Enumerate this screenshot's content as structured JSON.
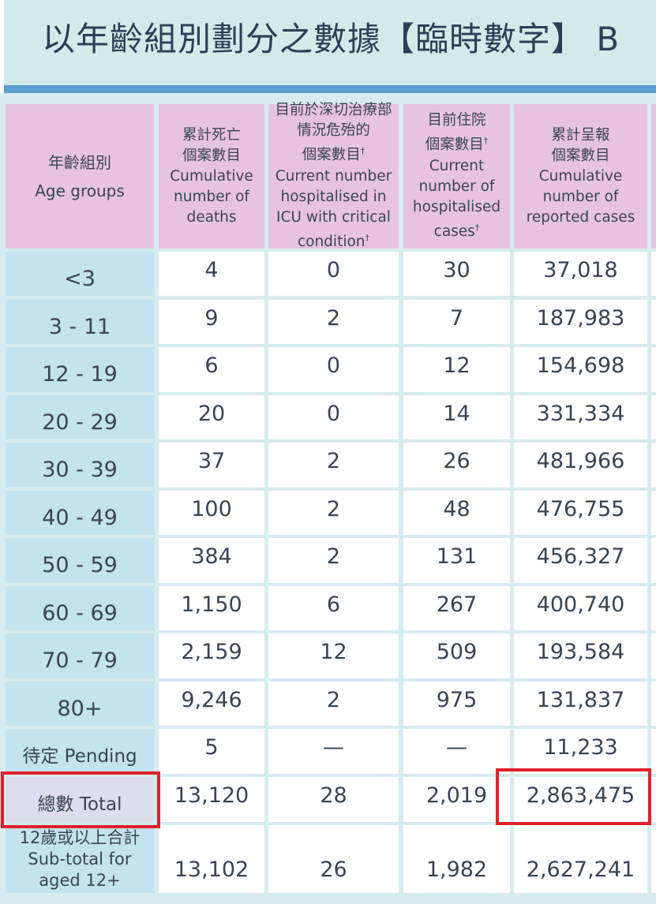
{
  "title": "以年齡組別劃分之數據【臨時數字】 B",
  "headers": {
    "age": [
      "年齡組別",
      "Age groups"
    ],
    "deaths": [
      "累計死亡",
      "個案數目",
      "Cumulative",
      "number of",
      "deaths"
    ],
    "icu": [
      "目前於深切治療部",
      "情況危殆的",
      "個案數目",
      "Current number",
      "hospitalised in",
      "ICU with critical",
      "condition"
    ],
    "hosp": [
      "目前住院",
      "個案數目",
      "Current",
      "number of",
      "hospitalised",
      "cases"
    ],
    "cases": [
      "累計呈報",
      "個案數目",
      "Cumulative",
      "number of",
      "reported cases"
    ],
    "dagger": "†"
  },
  "rows": [
    {
      "age": "<3",
      "deaths": "4",
      "icu": "0",
      "hosp": "30",
      "cases": "37,018"
    },
    {
      "age": "3 - 11",
      "deaths": "9",
      "icu": "2",
      "hosp": "7",
      "cases": "187,983"
    },
    {
      "age": "12 - 19",
      "deaths": "6",
      "icu": "0",
      "hosp": "12",
      "cases": "154,698"
    },
    {
      "age": "20 - 29",
      "deaths": "20",
      "icu": "0",
      "hosp": "14",
      "cases": "331,334"
    },
    {
      "age": "30 - 39",
      "deaths": "37",
      "icu": "2",
      "hosp": "26",
      "cases": "481,966"
    },
    {
      "age": "40 - 49",
      "deaths": "100",
      "icu": "2",
      "hosp": "48",
      "cases": "476,755"
    },
    {
      "age": "50 - 59",
      "deaths": "384",
      "icu": "2",
      "hosp": "131",
      "cases": "456,327"
    },
    {
      "age": "60 - 69",
      "deaths": "1,150",
      "icu": "6",
      "hosp": "267",
      "cases": "400,740"
    },
    {
      "age": "70 - 79",
      "deaths": "2,159",
      "icu": "12",
      "hosp": "509",
      "cases": "193,584"
    },
    {
      "age": "80+",
      "deaths": "9,246",
      "icu": "2",
      "hosp": "975",
      "cases": "131,837"
    },
    {
      "age": "待定 Pending",
      "deaths": "5",
      "icu": "—",
      "hosp": "—",
      "cases": "11,233"
    },
    {
      "age": "總數 Total",
      "deaths": "13,120",
      "icu": "28",
      "hosp": "2,019",
      "cases": "2,863,475"
    }
  ],
  "subtotal": {
    "age": [
      "12歲或以上合計",
      "Sub-total for",
      "aged 12+"
    ],
    "deaths": "13,102",
    "icu": "26",
    "hosp": "1,982",
    "cases": "2,627,241"
  },
  "colors": {
    "title_bg": "#d2ebea",
    "title_rule": "#5b9fd4",
    "header_bg": "#e7c3e0",
    "age_bg": "#c3e3ee",
    "total_bg": "#dcdfeb",
    "highlight": "#e0202c"
  }
}
